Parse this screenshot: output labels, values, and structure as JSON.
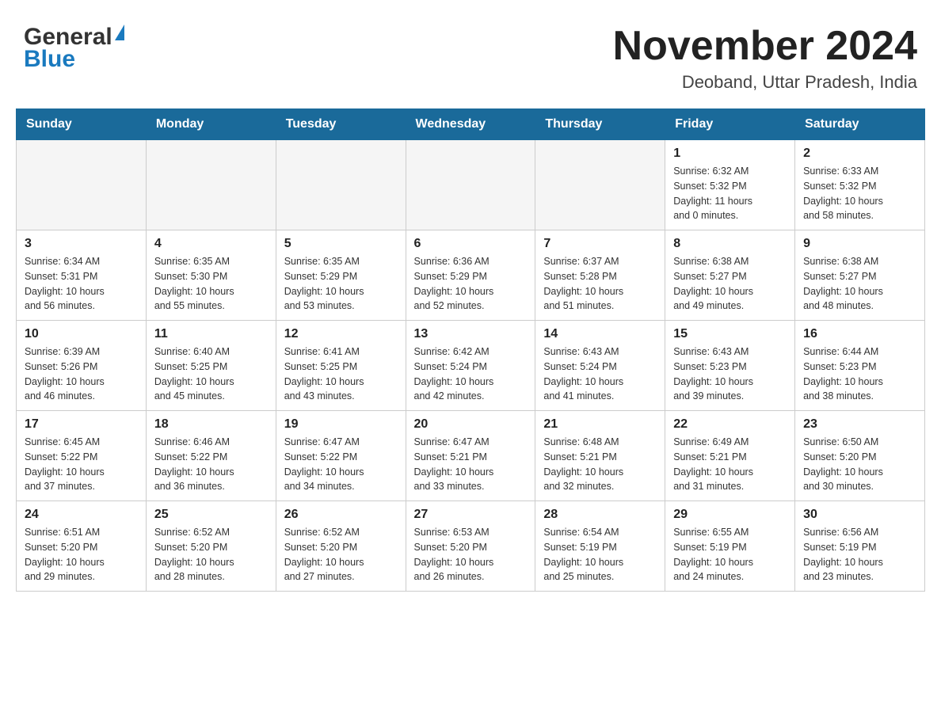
{
  "header": {
    "logo_general": "General",
    "logo_blue": "Blue",
    "title": "November 2024",
    "subtitle": "Deoband, Uttar Pradesh, India"
  },
  "calendar": {
    "headers": [
      "Sunday",
      "Monday",
      "Tuesday",
      "Wednesday",
      "Thursday",
      "Friday",
      "Saturday"
    ],
    "weeks": [
      [
        {
          "day": "",
          "info": ""
        },
        {
          "day": "",
          "info": ""
        },
        {
          "day": "",
          "info": ""
        },
        {
          "day": "",
          "info": ""
        },
        {
          "day": "",
          "info": ""
        },
        {
          "day": "1",
          "info": "Sunrise: 6:32 AM\nSunset: 5:32 PM\nDaylight: 11 hours\nand 0 minutes."
        },
        {
          "day": "2",
          "info": "Sunrise: 6:33 AM\nSunset: 5:32 PM\nDaylight: 10 hours\nand 58 minutes."
        }
      ],
      [
        {
          "day": "3",
          "info": "Sunrise: 6:34 AM\nSunset: 5:31 PM\nDaylight: 10 hours\nand 56 minutes."
        },
        {
          "day": "4",
          "info": "Sunrise: 6:35 AM\nSunset: 5:30 PM\nDaylight: 10 hours\nand 55 minutes."
        },
        {
          "day": "5",
          "info": "Sunrise: 6:35 AM\nSunset: 5:29 PM\nDaylight: 10 hours\nand 53 minutes."
        },
        {
          "day": "6",
          "info": "Sunrise: 6:36 AM\nSunset: 5:29 PM\nDaylight: 10 hours\nand 52 minutes."
        },
        {
          "day": "7",
          "info": "Sunrise: 6:37 AM\nSunset: 5:28 PM\nDaylight: 10 hours\nand 51 minutes."
        },
        {
          "day": "8",
          "info": "Sunrise: 6:38 AM\nSunset: 5:27 PM\nDaylight: 10 hours\nand 49 minutes."
        },
        {
          "day": "9",
          "info": "Sunrise: 6:38 AM\nSunset: 5:27 PM\nDaylight: 10 hours\nand 48 minutes."
        }
      ],
      [
        {
          "day": "10",
          "info": "Sunrise: 6:39 AM\nSunset: 5:26 PM\nDaylight: 10 hours\nand 46 minutes."
        },
        {
          "day": "11",
          "info": "Sunrise: 6:40 AM\nSunset: 5:25 PM\nDaylight: 10 hours\nand 45 minutes."
        },
        {
          "day": "12",
          "info": "Sunrise: 6:41 AM\nSunset: 5:25 PM\nDaylight: 10 hours\nand 43 minutes."
        },
        {
          "day": "13",
          "info": "Sunrise: 6:42 AM\nSunset: 5:24 PM\nDaylight: 10 hours\nand 42 minutes."
        },
        {
          "day": "14",
          "info": "Sunrise: 6:43 AM\nSunset: 5:24 PM\nDaylight: 10 hours\nand 41 minutes."
        },
        {
          "day": "15",
          "info": "Sunrise: 6:43 AM\nSunset: 5:23 PM\nDaylight: 10 hours\nand 39 minutes."
        },
        {
          "day": "16",
          "info": "Sunrise: 6:44 AM\nSunset: 5:23 PM\nDaylight: 10 hours\nand 38 minutes."
        }
      ],
      [
        {
          "day": "17",
          "info": "Sunrise: 6:45 AM\nSunset: 5:22 PM\nDaylight: 10 hours\nand 37 minutes."
        },
        {
          "day": "18",
          "info": "Sunrise: 6:46 AM\nSunset: 5:22 PM\nDaylight: 10 hours\nand 36 minutes."
        },
        {
          "day": "19",
          "info": "Sunrise: 6:47 AM\nSunset: 5:22 PM\nDaylight: 10 hours\nand 34 minutes."
        },
        {
          "day": "20",
          "info": "Sunrise: 6:47 AM\nSunset: 5:21 PM\nDaylight: 10 hours\nand 33 minutes."
        },
        {
          "day": "21",
          "info": "Sunrise: 6:48 AM\nSunset: 5:21 PM\nDaylight: 10 hours\nand 32 minutes."
        },
        {
          "day": "22",
          "info": "Sunrise: 6:49 AM\nSunset: 5:21 PM\nDaylight: 10 hours\nand 31 minutes."
        },
        {
          "day": "23",
          "info": "Sunrise: 6:50 AM\nSunset: 5:20 PM\nDaylight: 10 hours\nand 30 minutes."
        }
      ],
      [
        {
          "day": "24",
          "info": "Sunrise: 6:51 AM\nSunset: 5:20 PM\nDaylight: 10 hours\nand 29 minutes."
        },
        {
          "day": "25",
          "info": "Sunrise: 6:52 AM\nSunset: 5:20 PM\nDaylight: 10 hours\nand 28 minutes."
        },
        {
          "day": "26",
          "info": "Sunrise: 6:52 AM\nSunset: 5:20 PM\nDaylight: 10 hours\nand 27 minutes."
        },
        {
          "day": "27",
          "info": "Sunrise: 6:53 AM\nSunset: 5:20 PM\nDaylight: 10 hours\nand 26 minutes."
        },
        {
          "day": "28",
          "info": "Sunrise: 6:54 AM\nSunset: 5:19 PM\nDaylight: 10 hours\nand 25 minutes."
        },
        {
          "day": "29",
          "info": "Sunrise: 6:55 AM\nSunset: 5:19 PM\nDaylight: 10 hours\nand 24 minutes."
        },
        {
          "day": "30",
          "info": "Sunrise: 6:56 AM\nSunset: 5:19 PM\nDaylight: 10 hours\nand 23 minutes."
        }
      ]
    ]
  }
}
